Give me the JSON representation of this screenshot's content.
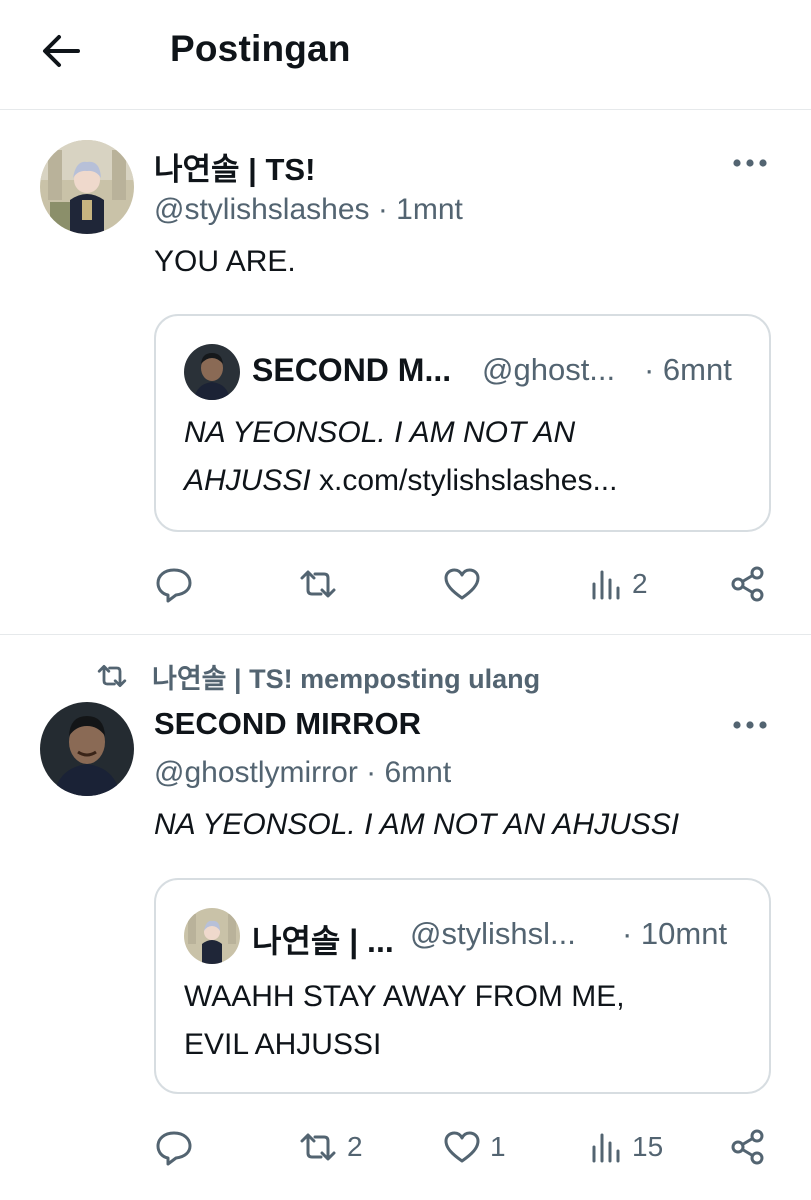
{
  "header": {
    "title": "Postingan",
    "back_icon": "arrow-left-icon"
  },
  "posts": [
    {
      "author_name": "나연솔 | TS!",
      "author_handle_time": "@stylishslashes · 1mnt",
      "text": "YOU ARE.",
      "quote": {
        "name": "SECOND M...",
        "handle": "@ghost...",
        "time": "· 6mnt",
        "text_line1": "NA YEONSOL. I AM NOT AN",
        "text_line2_italic": "AHJUSSI",
        "text_line2_link": " x.com/stylishslashes..."
      },
      "actions": {
        "reply": "",
        "repost": "",
        "like": "",
        "views": "2"
      }
    },
    {
      "repost_label": "나연솔 | TS! memposting ulang",
      "author_name": "SECOND MIRROR",
      "author_handle_time": "@ghostlymirror · 6mnt",
      "text": "NA YEONSOL. I AM NOT AN AHJUSSI",
      "quote": {
        "name": "나연솔 | ...",
        "handle": "@stylishsl...",
        "time": "· 10mnt",
        "text_line1": "WAAHH STAY AWAY FROM ME,",
        "text_line2": "EVIL AHJUSSI"
      },
      "actions": {
        "reply": "",
        "repost": "2",
        "like": "1",
        "views": "15"
      }
    }
  ],
  "colors": {
    "text": "#0f1419",
    "secondary": "#536471",
    "border": "#d7dde1",
    "divider": "#e6e9eb"
  }
}
